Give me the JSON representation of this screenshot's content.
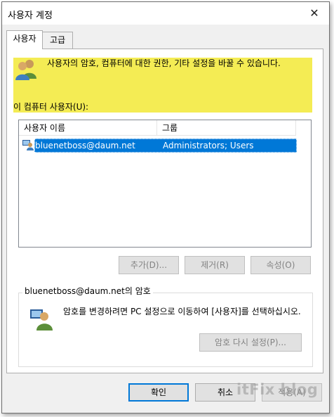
{
  "window": {
    "title": "사용자 계정"
  },
  "tabs": [
    {
      "label": "사용자",
      "active": true
    },
    {
      "label": "고급",
      "active": false
    }
  ],
  "info": {
    "description": "사용자의 암호, 컴퓨터에 대한 권한, 기타 설정을 바꿀 수 있습니다.",
    "users_label": "이 컴퓨터 사용자(U):"
  },
  "users_list": {
    "columns": [
      "사용자 이름",
      "그룹"
    ],
    "rows": [
      {
        "name": "bluenetboss@daum.net",
        "group": "Administrators; Users",
        "selected": true
      }
    ]
  },
  "user_buttons": {
    "add": "추가(D)...",
    "remove": "제거(R)",
    "properties": "속성(O)"
  },
  "password_section": {
    "title": "bluenetboss@daum.net의 암호",
    "text": "암호를 변경하려면 PC 설정으로 이동하여 [사용자]를 선택하십시오.",
    "reset_button": "암호 다시 설정(P)..."
  },
  "dialog_buttons": {
    "ok": "확인",
    "cancel": "취소",
    "apply": "적용(A)"
  },
  "watermark": "itFix blog",
  "colors": {
    "highlight": "#f4ec54",
    "selection": "#0078d7",
    "focus_border": "#0078d7"
  }
}
